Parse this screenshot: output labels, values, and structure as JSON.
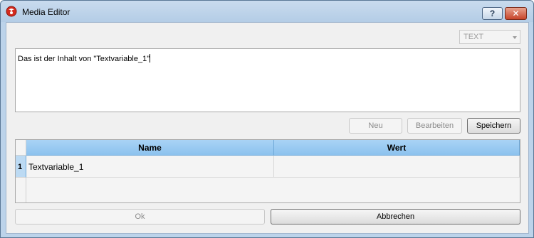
{
  "window": {
    "title": "Media Editor",
    "help_label": "?",
    "close_label": "✕"
  },
  "type_select": {
    "value": "TEXT"
  },
  "editor": {
    "content": "Das ist der Inhalt von \"Textvariable_1\""
  },
  "actions": {
    "new_label": "Neu",
    "edit_label": "Bearbeiten",
    "save_label": "Speichern"
  },
  "table": {
    "columns": [
      "Name",
      "Wert"
    ],
    "rows": [
      {
        "num": "1",
        "name": "Textvariable_1",
        "value": ""
      }
    ]
  },
  "footer": {
    "ok_label": "Ok",
    "cancel_label": "Abbrechen"
  },
  "colors": {
    "header_blue": "#8cc2ee",
    "close_red": "#c7442a"
  }
}
